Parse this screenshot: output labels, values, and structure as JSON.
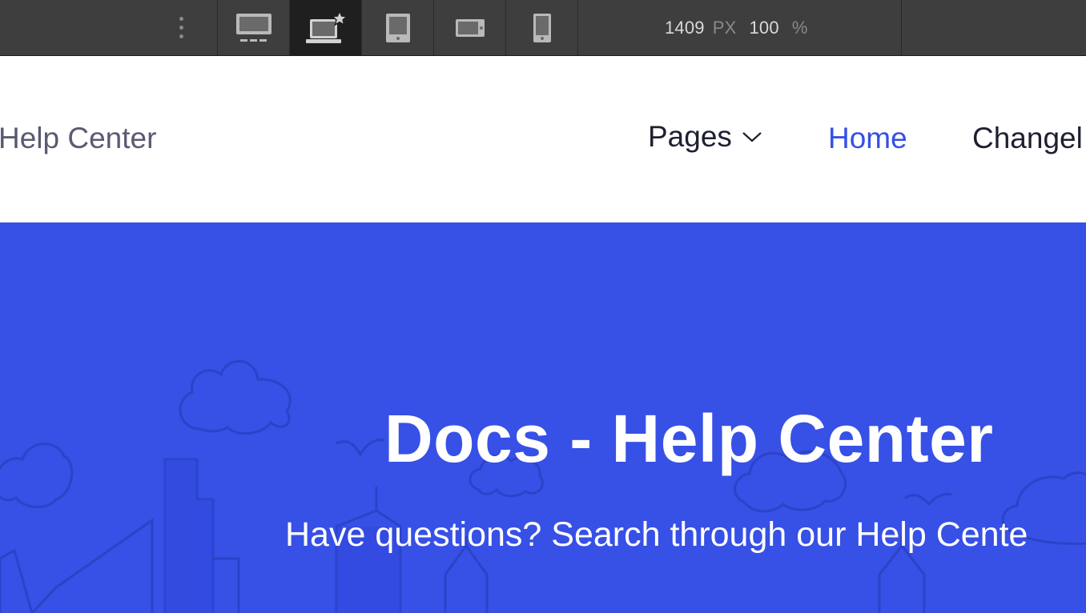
{
  "toolbar": {
    "breakpoints": [
      {
        "name": "desktop-wide",
        "icon": "monitor-icon",
        "active": false
      },
      {
        "name": "desktop-base",
        "icon": "laptop-star-icon",
        "active": true
      },
      {
        "name": "tablet",
        "icon": "tablet-icon",
        "active": false
      },
      {
        "name": "mobile-landscape",
        "icon": "phone-landscape-icon",
        "active": false
      },
      {
        "name": "mobile-portrait",
        "icon": "phone-portrait-icon",
        "active": false
      }
    ],
    "width_value": "1409",
    "width_unit": "PX",
    "zoom_value": "100",
    "zoom_unit": "%"
  },
  "header": {
    "brand": "Help Center",
    "nav": {
      "pages_label": "Pages",
      "home_label": "Home",
      "changelog_label": "Changel"
    }
  },
  "hero": {
    "title": "Docs - Help Center",
    "subtitle": "Have questions? Search through our Help Cente"
  },
  "colors": {
    "toolbar_bg": "#3e3e3e",
    "toolbar_active": "#1f1f1f",
    "hero_bg": "#3750e6",
    "link_active": "#3550e6",
    "text_dark": "#1e2030"
  }
}
